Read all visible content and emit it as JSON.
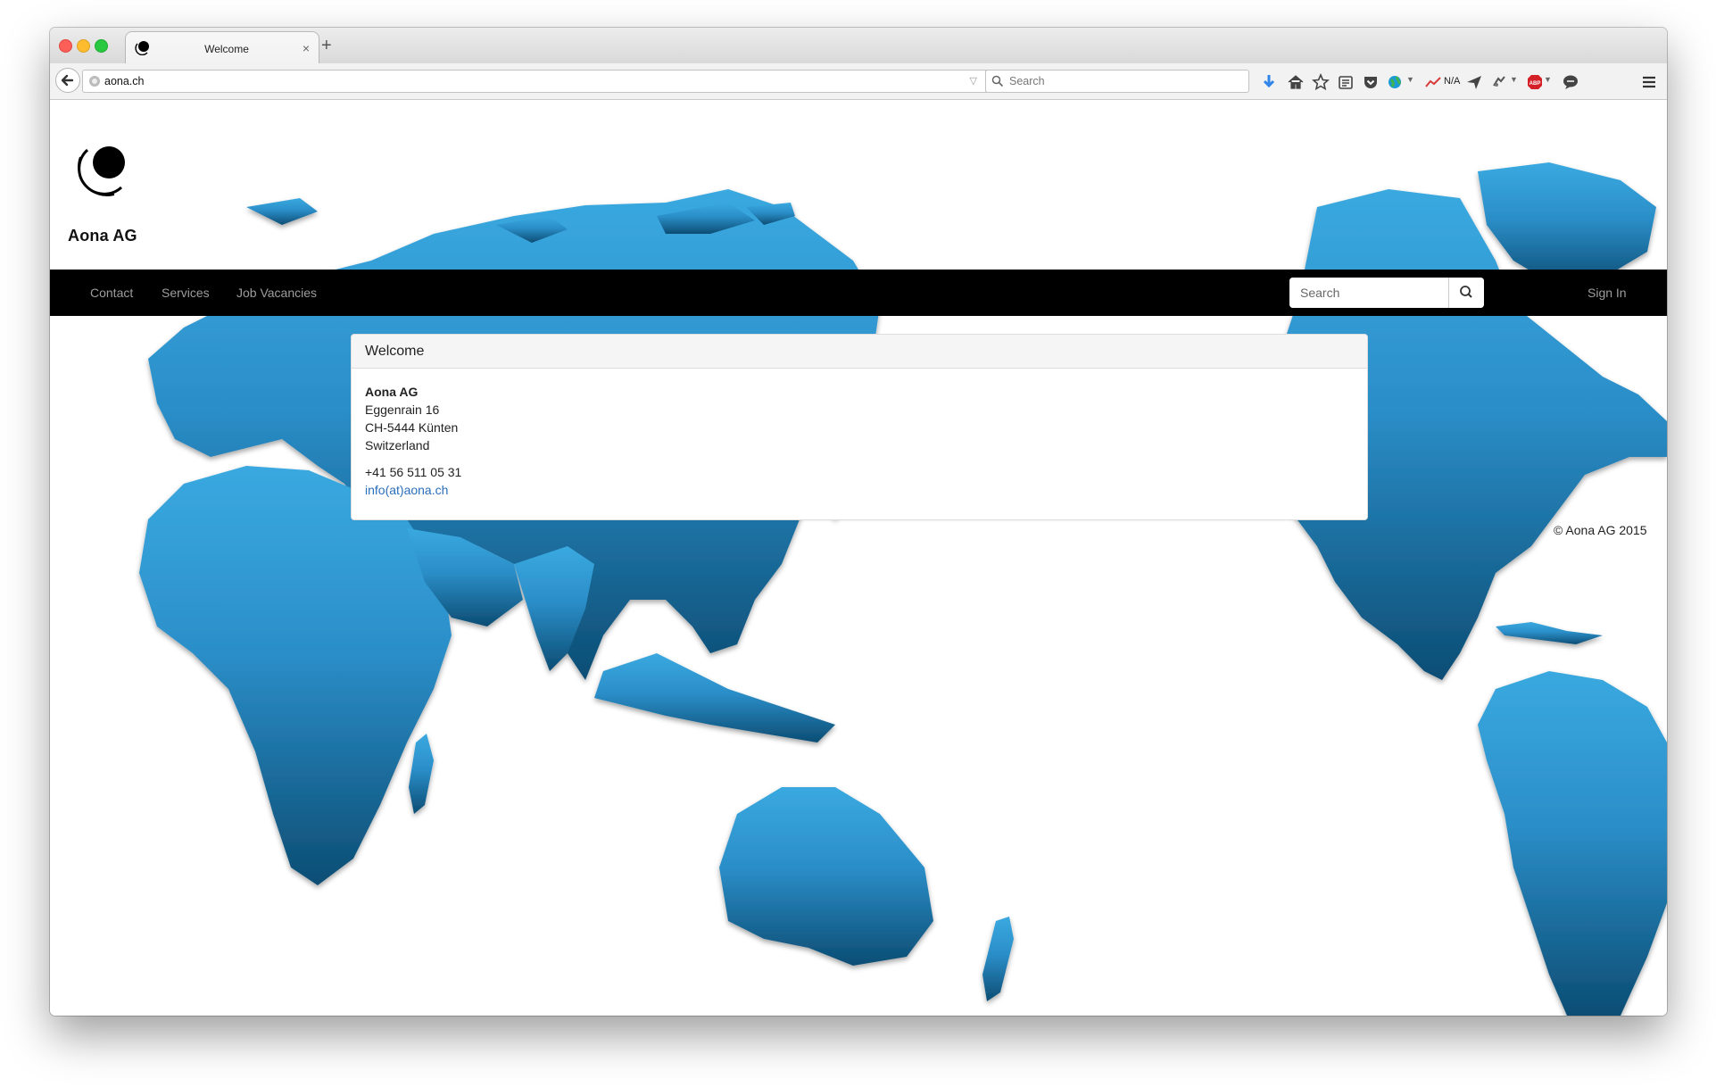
{
  "browser": {
    "tab_title": "Welcome",
    "tab_close": "×",
    "new_tab": "+",
    "url": "aona.ch",
    "search_placeholder": "Search",
    "toolbar_na_label": "N/A",
    "icons": [
      "back-arrow-icon",
      "globe-icon",
      "reload-icon",
      "search-icon",
      "download-icon",
      "home-icon",
      "bookmark-star-icon",
      "reading-list-icon",
      "pocket-icon",
      "extension-globe-icon",
      "chart-extension-icon",
      "send-icon",
      "puzzle-extension-icon",
      "adblock-plus-icon",
      "chat-icon",
      "hamburger-menu-icon"
    ]
  },
  "site": {
    "logo_text": "Aona AG",
    "nav": {
      "items": [
        "Contact",
        "Services",
        "Job Vacancies"
      ],
      "search_placeholder": "Search",
      "sign_in": "Sign In"
    },
    "panel": {
      "heading": "Welcome",
      "company": "Aona AG",
      "street": "Eggenrain 16",
      "city": "CH-5444 Künten",
      "country": "Switzerland",
      "phone": "+41 56 511 05 31",
      "email": "info(at)aona.ch"
    },
    "copyright": "© Aona AG 2015"
  },
  "colors": {
    "navbar_bg": "#000000",
    "nav_link": "#9d9d9d",
    "map_light": "#3aa9e0",
    "map_dark": "#0c4d74",
    "link": "#2a6ebb"
  }
}
